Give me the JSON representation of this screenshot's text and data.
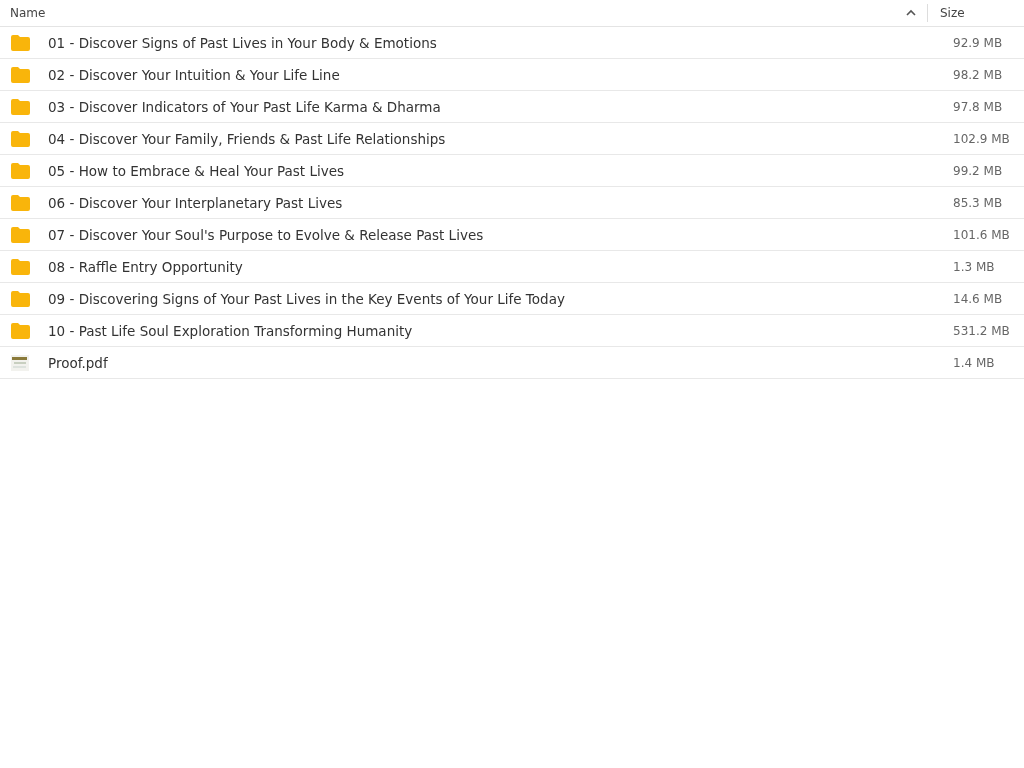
{
  "columns": [
    {
      "label": "Name",
      "sorted": true
    },
    {
      "label": "Size",
      "sorted": false
    }
  ],
  "rows": [
    {
      "kind": "folder",
      "name": "01 - Discover Signs of Past Lives in Your Body & Emotions",
      "size": "92.9 MB"
    },
    {
      "kind": "folder",
      "name": "02 - Discover Your Intuition & Your Life Line",
      "size": "98.2 MB"
    },
    {
      "kind": "folder",
      "name": "03 - Discover Indicators of Your Past Life Karma & Dharma",
      "size": "97.8 MB"
    },
    {
      "kind": "folder",
      "name": "04 - Discover Your Family, Friends & Past Life Relationships",
      "size": "102.9 MB"
    },
    {
      "kind": "folder",
      "name": "05 - How to Embrace & Heal Your Past Lives",
      "size": "99.2 MB"
    },
    {
      "kind": "folder",
      "name": "06 - Discover Your Interplanetary Past Lives",
      "size": "85.3 MB"
    },
    {
      "kind": "folder",
      "name": "07 - Discover Your Soul's Purpose to Evolve & Release Past Lives",
      "size": "101.6 MB"
    },
    {
      "kind": "folder",
      "name": "08 - Raffle Entry Opportunity",
      "size": "1.3 MB"
    },
    {
      "kind": "folder",
      "name": "09 - Discovering Signs of Your Past Lives in the Key Events of Your Life Today",
      "size": "14.6 MB"
    },
    {
      "kind": "folder",
      "name": "10 - Past Life Soul Exploration Transforming Humanity",
      "size": "531.2 MB"
    },
    {
      "kind": "pdf",
      "name": "Proof.pdf",
      "size": "1.4 MB"
    }
  ]
}
